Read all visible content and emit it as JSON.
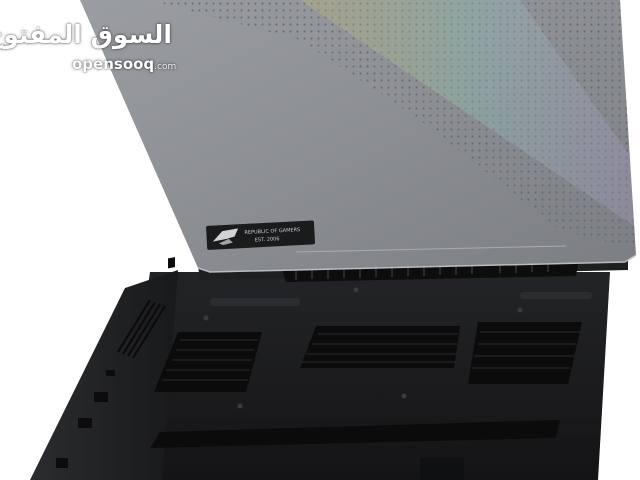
{
  "watermark": {
    "arabic_name": "السوق المفتوح",
    "domain_name": "opensooq",
    "domain_tld": ".com"
  },
  "lid_badge": {
    "text_line1": "REPUBLIC OF GAMERS",
    "text_line2": "EST. 2006"
  },
  "colors": {
    "lid": "#8c8f93",
    "lid_highlight": "#a7aaae",
    "base": "#1c1d1f",
    "vents": "#0b0b0c",
    "background": "#ffffff"
  },
  "icons": [
    "rog-eye-logo",
    "dot-matrix-pattern",
    "vent-grille"
  ]
}
